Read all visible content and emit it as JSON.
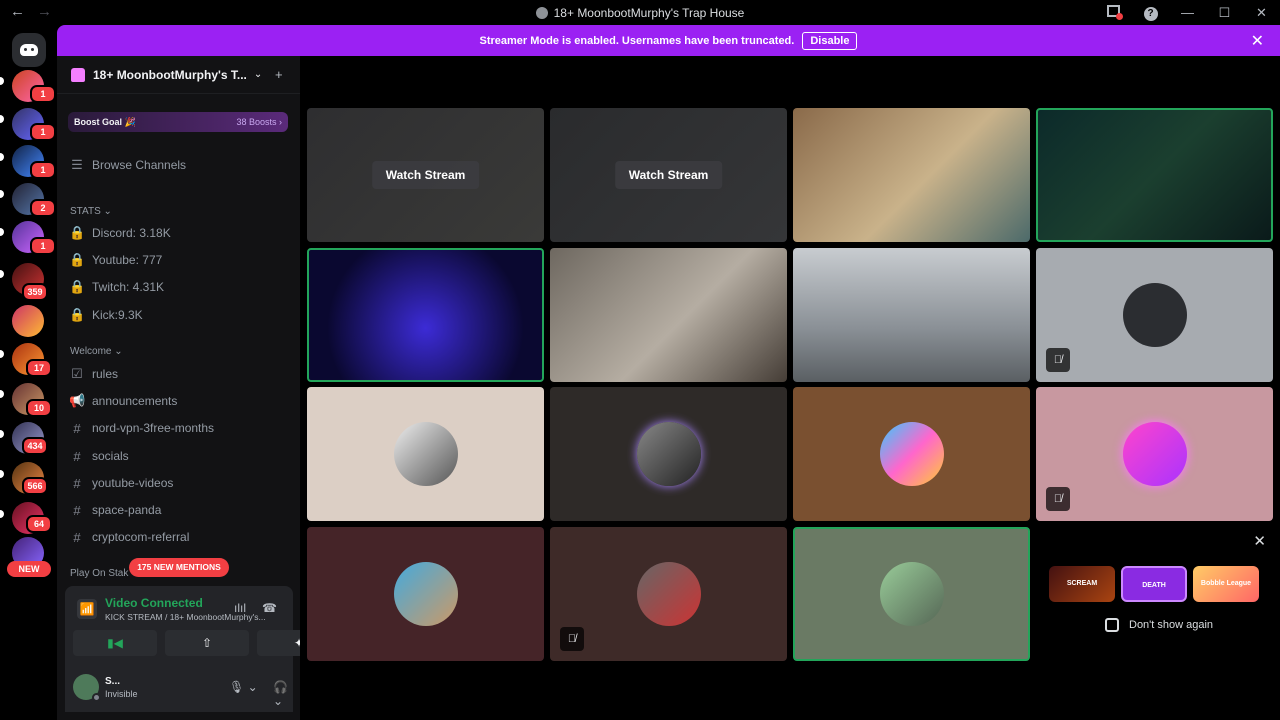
{
  "window": {
    "title": "18+ MoonbootMurphy's Trap House",
    "back_icon": "←",
    "forward_icon": "→",
    "minimize": "—",
    "maximize": "☐",
    "close": "✕",
    "help": "?"
  },
  "guilds": {
    "badges": [
      "1",
      "1",
      "1",
      "2",
      "1",
      "359",
      "17",
      "10",
      "434",
      "566",
      "64"
    ],
    "new_label": "NEW"
  },
  "banner": {
    "message": "Streamer Mode is enabled. Usernames have been truncated.",
    "button": "Disable",
    "close": "✕"
  },
  "server": {
    "name": "18+ MoonbootMurphy's T...",
    "chevron": "⌄",
    "invite_icon": "+",
    "boost_goal": "Boost Goal 🎉",
    "boost_count": "38 Boosts ›",
    "browse": "Browse Channels",
    "stats_category": "STATS ⌄",
    "stats": [
      "Discord: 3.18K",
      "Youtube: 777",
      "Twitch: 4.31K",
      "Kick:9.3K"
    ],
    "welcome_category": "Welcome ⌄",
    "channels": [
      "rules",
      "announcements",
      "nord-vpn-3free-months",
      "socials",
      "youtube-videos",
      "space-panda",
      "cryptocom-referral"
    ],
    "play_on_stake": "Play On Stak",
    "mentions": "175 NEW MENTIONS"
  },
  "voice": {
    "status": "Video Connected",
    "channel": "KICK STREAM / 18+ MoonbootMurphy's...",
    "wave_icon": "ılıl",
    "hangup_icon": "☎",
    "video_icon": "▮◀",
    "share_icon": "⇧",
    "activity_icon": "✦"
  },
  "user": {
    "name": "S...",
    "status": "Invisible",
    "mic_icon": "🎙 ⌄",
    "headset_icon": "🎧 ⌄",
    "settings_icon": "⚙"
  },
  "stage": {
    "watch_stream": "Watch Stream",
    "mute_icon": "🎙̸"
  },
  "promo": {
    "close": "✕",
    "games": [
      "SCREAM",
      "DEATH",
      "Bobble League"
    ],
    "dont_show": "Don't show again"
  },
  "colors": {
    "accent": "#9b21f3",
    "speaking": "#23a55a",
    "badge": "#f23f43"
  }
}
